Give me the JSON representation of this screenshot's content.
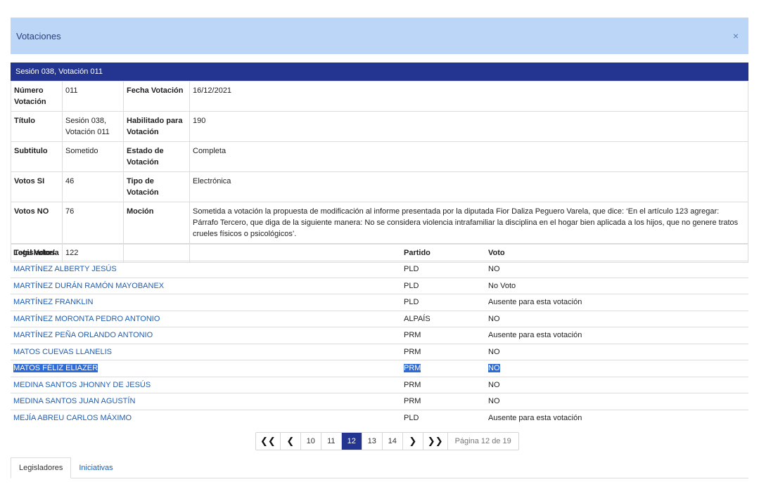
{
  "modal": {
    "title": "Votaciones",
    "close_glyph": "×"
  },
  "session_title": "Sesión 038, Votación 011",
  "details": {
    "numero_label": "Número Votación",
    "numero": "011",
    "fecha_label": "Fecha Votación",
    "fecha": "16/12/2021",
    "titulo_label": "Título",
    "titulo": "Sesión 038, Votación 011",
    "habilitado_label": "Habilitado para Votación",
    "habilitado": "190",
    "subtitulo_label": "Subtitulo",
    "subtitulo": "Sometido",
    "estado_label": "Estado de Votación",
    "estado": "Completa",
    "votos_si_label": "Votos SI",
    "votos_si": "46",
    "tipo_label": "Tipo de Votación",
    "tipo": "Electrónica",
    "votos_no_label": "Votos NO",
    "votos_no": "76",
    "mocion_label": "Moción",
    "mocion": "Sometida a votación la propuesta de modificación al informe presentada por la diputada Fior Daliza Peguero Varela, que dice: ‘En el artículo 123 agregar: Párrafo Tercero, que diga de la siguiente manera: No se considera violencia intrafamiliar la disciplina en el hogar bien aplicada a los hijos, que no genere tratos crueles físicos o psicológicos’.",
    "total_label": "Total Votos",
    "total": "122"
  },
  "votes_table": {
    "headers": {
      "name": "Legislador/a",
      "party": "Partido",
      "vote": "Voto"
    },
    "rows": [
      {
        "name": "MARTÍNEZ ALBERTY JESÚS",
        "party": "PLD",
        "vote": "NO"
      },
      {
        "name": "MARTÍNEZ DURÁN RAMÓN MAYOBANEX",
        "party": "PLD",
        "vote": "No Voto"
      },
      {
        "name": "MARTÍNEZ FRANKLIN",
        "party": "PLD",
        "vote": "Ausente para esta votación"
      },
      {
        "name": "MARTÍNEZ MORONTA PEDRO ANTONIO",
        "party": "ALPAÍS",
        "vote": "NO"
      },
      {
        "name": "MARTÍNEZ PEÑA ORLANDO ANTONIO",
        "party": "PRM",
        "vote": "Ausente para esta votación"
      },
      {
        "name": "MATOS CUEVAS LLANELIS",
        "party": "PRM",
        "vote": "NO"
      },
      {
        "name": "MATOS FÉLIZ ELIAZER",
        "party": "PRM",
        "vote": "NO"
      },
      {
        "name": "MEDINA SANTOS JHONNY DE JESÚS",
        "party": "PRM",
        "vote": "NO"
      },
      {
        "name": "MEDINA SANTOS JUAN AGUSTÍN",
        "party": "PRM",
        "vote": "NO"
      },
      {
        "name": "MEJÍA ABREU CARLOS MÁXIMO",
        "party": "PLD",
        "vote": "Ausente para esta votación"
      }
    ]
  },
  "pagination": {
    "first_glyph": "❮❮",
    "prev_glyph": "❮",
    "next_glyph": "❯",
    "last_glyph": "❯❯",
    "pages": [
      "10",
      "11",
      "12",
      "13",
      "14"
    ],
    "current": "12",
    "info": "Página 12 de 19"
  },
  "tabs": {
    "legisladores": "Legisladores",
    "iniciativas": "Iniciativas"
  }
}
